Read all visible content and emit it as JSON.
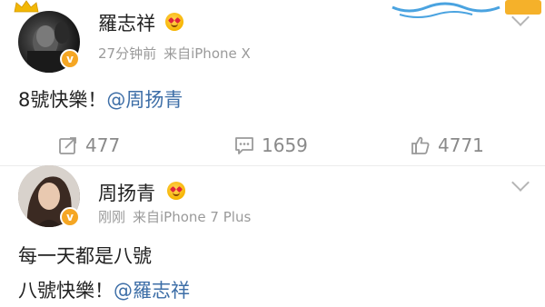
{
  "posts": [
    {
      "author": "羅志祥",
      "time": "27分钟前",
      "source": "来自iPhone X",
      "text_prefix": "8號快樂！",
      "mention": "@周扬青",
      "actions": {
        "repost_count": "477",
        "comment_count": "1659",
        "like_count": "4771"
      }
    },
    {
      "author": "周扬青",
      "time": "刚刚",
      "source": "来自iPhone 7 Plus",
      "line1": "每一天都是八號",
      "line2_prefix": "八號快樂！",
      "mention": "@羅志祥"
    }
  ],
  "verified_badge_symbol": "v",
  "colors": {
    "mention": "#3d6ea7",
    "meta": "#9a9a9a",
    "badge": "#f5a623",
    "action": "#8a8a8a"
  },
  "icons": {
    "repost": "repost-icon",
    "comment": "comment-icon",
    "like": "like-icon",
    "more": "chevron-down-icon",
    "crown": "crown-icon"
  }
}
